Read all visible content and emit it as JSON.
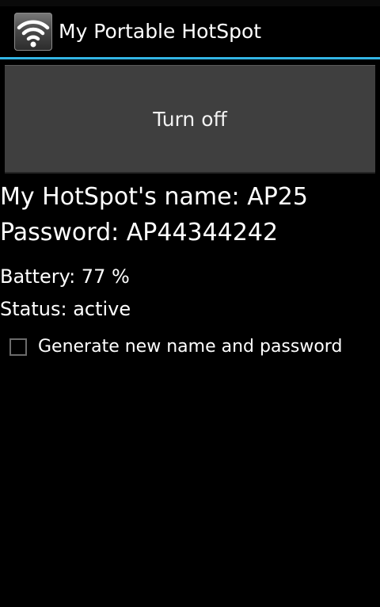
{
  "app": {
    "title": "My Portable HotSpot",
    "icon": "wifi-icon",
    "accent_color": "#33b5e5"
  },
  "toggle_button": {
    "label": "Turn off"
  },
  "info": {
    "hotspot_name": "My HotSpot's name: AP25",
    "password": "Password: AP44344242",
    "battery": "Battery: 77 %",
    "status": "Status: active"
  },
  "options": {
    "generate_new_label": "Generate new name and password",
    "generate_new_checked": false
  }
}
